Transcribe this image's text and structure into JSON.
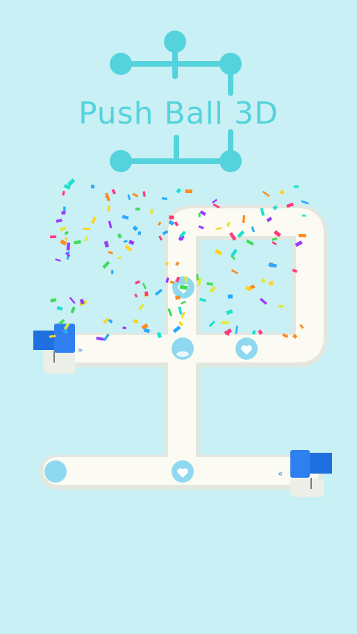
{
  "game": {
    "title": "Push Ball 3D",
    "colors": {
      "background": "#c9f0f4",
      "logo": "#55d3dd",
      "track": "#fbfbf3",
      "track_edge": "#e4e8e0",
      "pusher": "#1f6fe0",
      "ball": "#8ed9f0"
    },
    "balls": [
      {
        "name": "ball-top-heart",
        "icon": "heart-icon"
      },
      {
        "name": "ball-middle-plain",
        "icon": ""
      },
      {
        "name": "ball-right-heart",
        "icon": "heart-icon"
      },
      {
        "name": "ball-bottom-left-plain",
        "icon": ""
      },
      {
        "name": "ball-bottom-center-heart",
        "icon": "heart-icon"
      }
    ],
    "pushers": [
      {
        "name": "left-pusher",
        "direction": "right"
      },
      {
        "name": "right-pusher",
        "direction": "left"
      }
    ],
    "effects": {
      "confetti": true
    }
  }
}
